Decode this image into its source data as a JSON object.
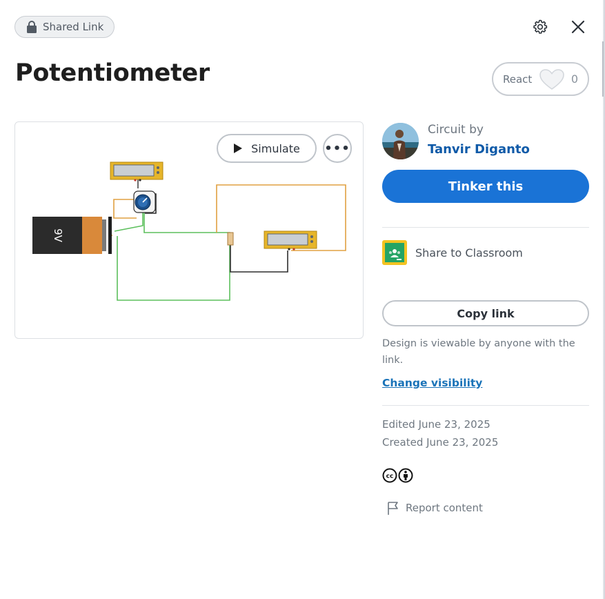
{
  "header": {
    "shared_label": "Shared Link",
    "lock_icon": "lock-icon",
    "settings_icon": "gear-icon",
    "close_icon": "close-icon"
  },
  "design": {
    "title": "Potentiometer"
  },
  "react": {
    "label": "React",
    "count": "0",
    "icon": "heart-icon"
  },
  "preview": {
    "simulate_label": "Simulate",
    "more_label": "•••",
    "battery_label": "9V"
  },
  "author": {
    "circuit_by_label": "Circuit by",
    "name": "Tanvir Diganto"
  },
  "actions": {
    "tinker_label": "Tinker this",
    "share_classroom_label": "Share to Classroom",
    "copy_link_label": "Copy link",
    "visibility_note": "Design is viewable by anyone with the link.",
    "change_visibility_label": "Change visibility"
  },
  "meta": {
    "edited": "Edited June 23, 2025",
    "created": "Created June 23, 2025",
    "license_icons": [
      "cc-icon",
      "by-icon"
    ],
    "report_label": "Report content"
  },
  "colors": {
    "primary": "#1a73d6",
    "link": "#0f5aa8",
    "wire_green": "#5bbf5b",
    "wire_orange": "#e0a040",
    "component_yellow": "#e6b52a"
  }
}
